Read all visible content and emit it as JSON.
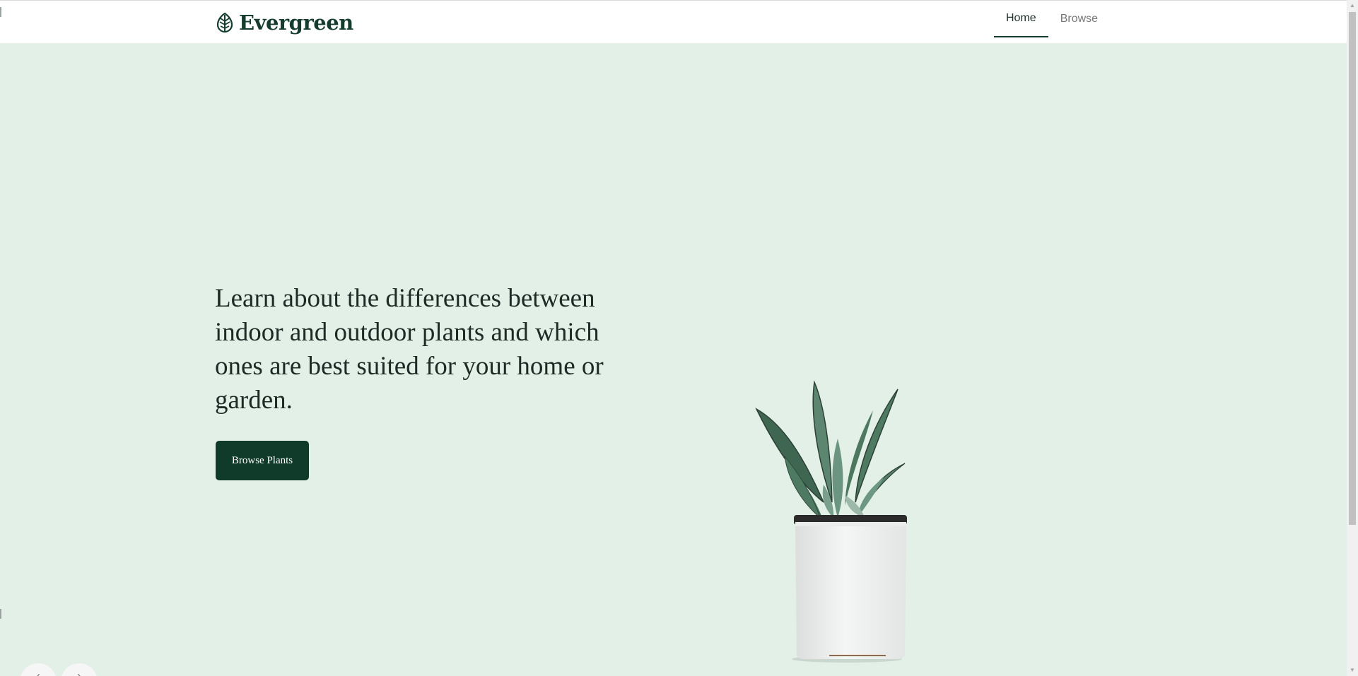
{
  "header": {
    "brand": "Evergreen",
    "brand_icon": "leaf-icon",
    "nav": [
      {
        "label": "Home",
        "active": true
      },
      {
        "label": "Browse",
        "active": false
      }
    ]
  },
  "hero": {
    "headline": "Learn about the differences between indoor and outdoor plants and which ones are best suited for your home or garden.",
    "cta_label": "Browse Plants",
    "image": "potted-succulent",
    "prev_icon": "‹",
    "next_icon": "›"
  },
  "colors": {
    "brand": "#143d2e",
    "hero_background": "#e3f0e8",
    "cta_background": "#103a2a"
  }
}
